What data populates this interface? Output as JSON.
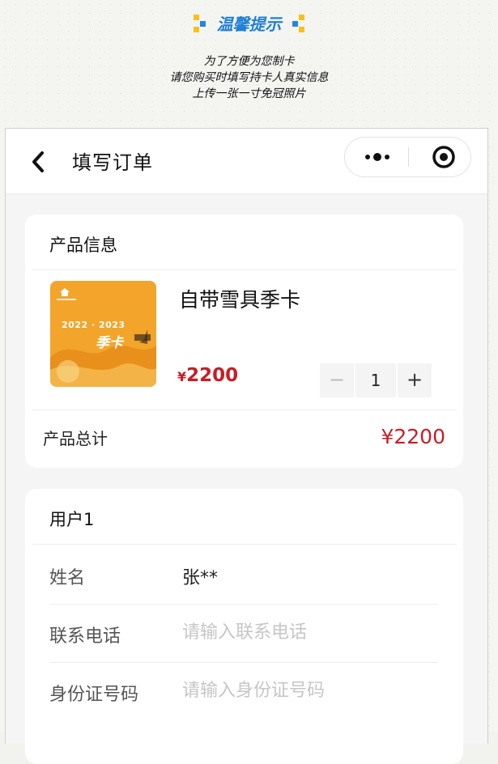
{
  "notice": {
    "title": "温馨提示",
    "lines": [
      "为了方便为您制卡",
      "请您购买时填写持卡人真实信息",
      "上传一张一寸免冠照片"
    ]
  },
  "navbar": {
    "title": "填写订单",
    "back_icon": "chevron-left-icon",
    "more_icon": "more-dots-icon",
    "close_icon": "target-close-icon"
  },
  "product_card": {
    "header": "产品信息",
    "product": {
      "name": "自带雪具季卡",
      "price_symbol": "¥",
      "price": "2200",
      "thumb_year": "2022 · 2023",
      "thumb_title": "季卡",
      "quantity": "1",
      "minus_label": "−",
      "plus_label": "+"
    },
    "total_label": "产品总计",
    "total_value": "¥2200"
  },
  "user_card": {
    "header": "用户1",
    "fields": [
      {
        "label": "姓名",
        "value": "张**"
      },
      {
        "label": "联系电话",
        "placeholder": "请输入联系电话"
      },
      {
        "label": "身份证号码",
        "placeholder": "请输入身份证号码"
      }
    ]
  },
  "colors": {
    "accent_blue": "#1f7fd6",
    "accent_yellow": "#f5c21b",
    "price_red": "#c81d25",
    "thumb_orange": "#f2a52a"
  }
}
